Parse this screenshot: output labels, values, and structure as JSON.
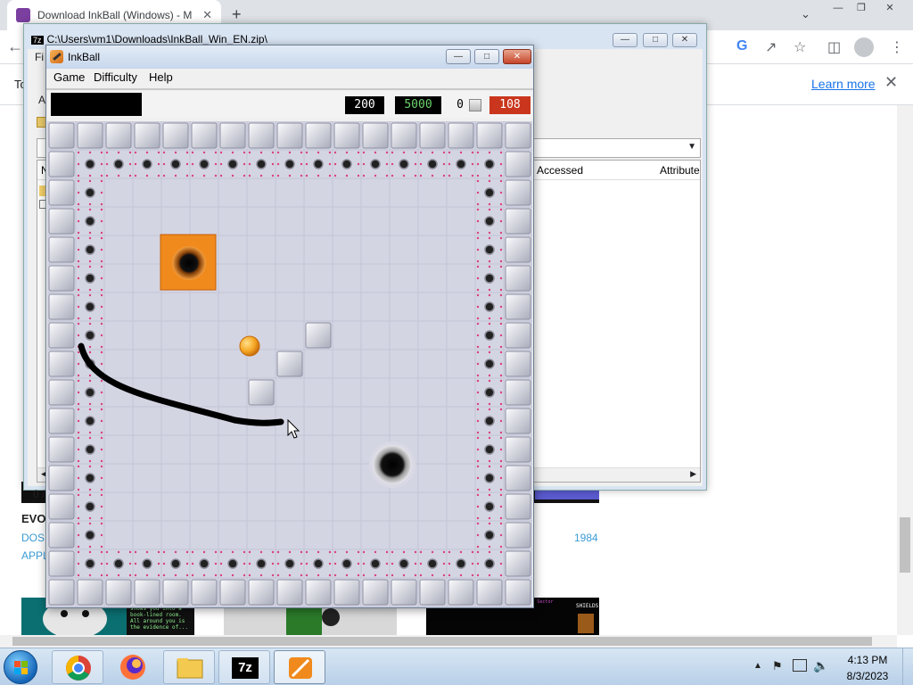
{
  "browser": {
    "tab_title": "Download InkBall (Windows) - M",
    "infobar_left": "To",
    "learn_more": "Learn more",
    "new_tab_glyph": "+",
    "tab_search_glyph": "⌄",
    "close_glyph": "✕"
  },
  "page": {
    "game_title": "EVOL",
    "link_dos": "DOS,",
    "link_apple": "APPL",
    "year": "1984",
    "thumb2_text": "Feeling... The maid shows you into a book-lined room. All around you is the evidence of...",
    "thumb3_text": "Mr exit him in REPUBLIC by BRILLIANT in Sector B. 00",
    "thumb3_label": "SHIELDS"
  },
  "zip": {
    "badge": "7z",
    "path": "C:\\Users\\vm1\\Downloads\\InkBall_Win_EN.zip\\",
    "menu_first": "Fi",
    "col_name": "N",
    "col_accessed": "Accessed",
    "col_attributes": "Attribute",
    "status": "0 /",
    "side_letter": "A"
  },
  "inkball": {
    "title": "InkBall",
    "menu": [
      "Game",
      "Difficulty",
      "Help"
    ],
    "score": "200",
    "time": "5000",
    "count": "0",
    "balls_left": "108",
    "colors": {
      "board": "#d4d5e3",
      "tile": "#cfd1de",
      "hole_orange": "#f08a1c",
      "ball": "#f5a623",
      "ink": "#000000",
      "dot_border": "#d9417a"
    }
  },
  "taskbar": {
    "time": "4:13 PM",
    "date": "8/3/2023",
    "apps": [
      "chrome",
      "firefox",
      "file-explorer",
      "7-zip",
      "inkball"
    ],
    "zip_label": "7z"
  }
}
